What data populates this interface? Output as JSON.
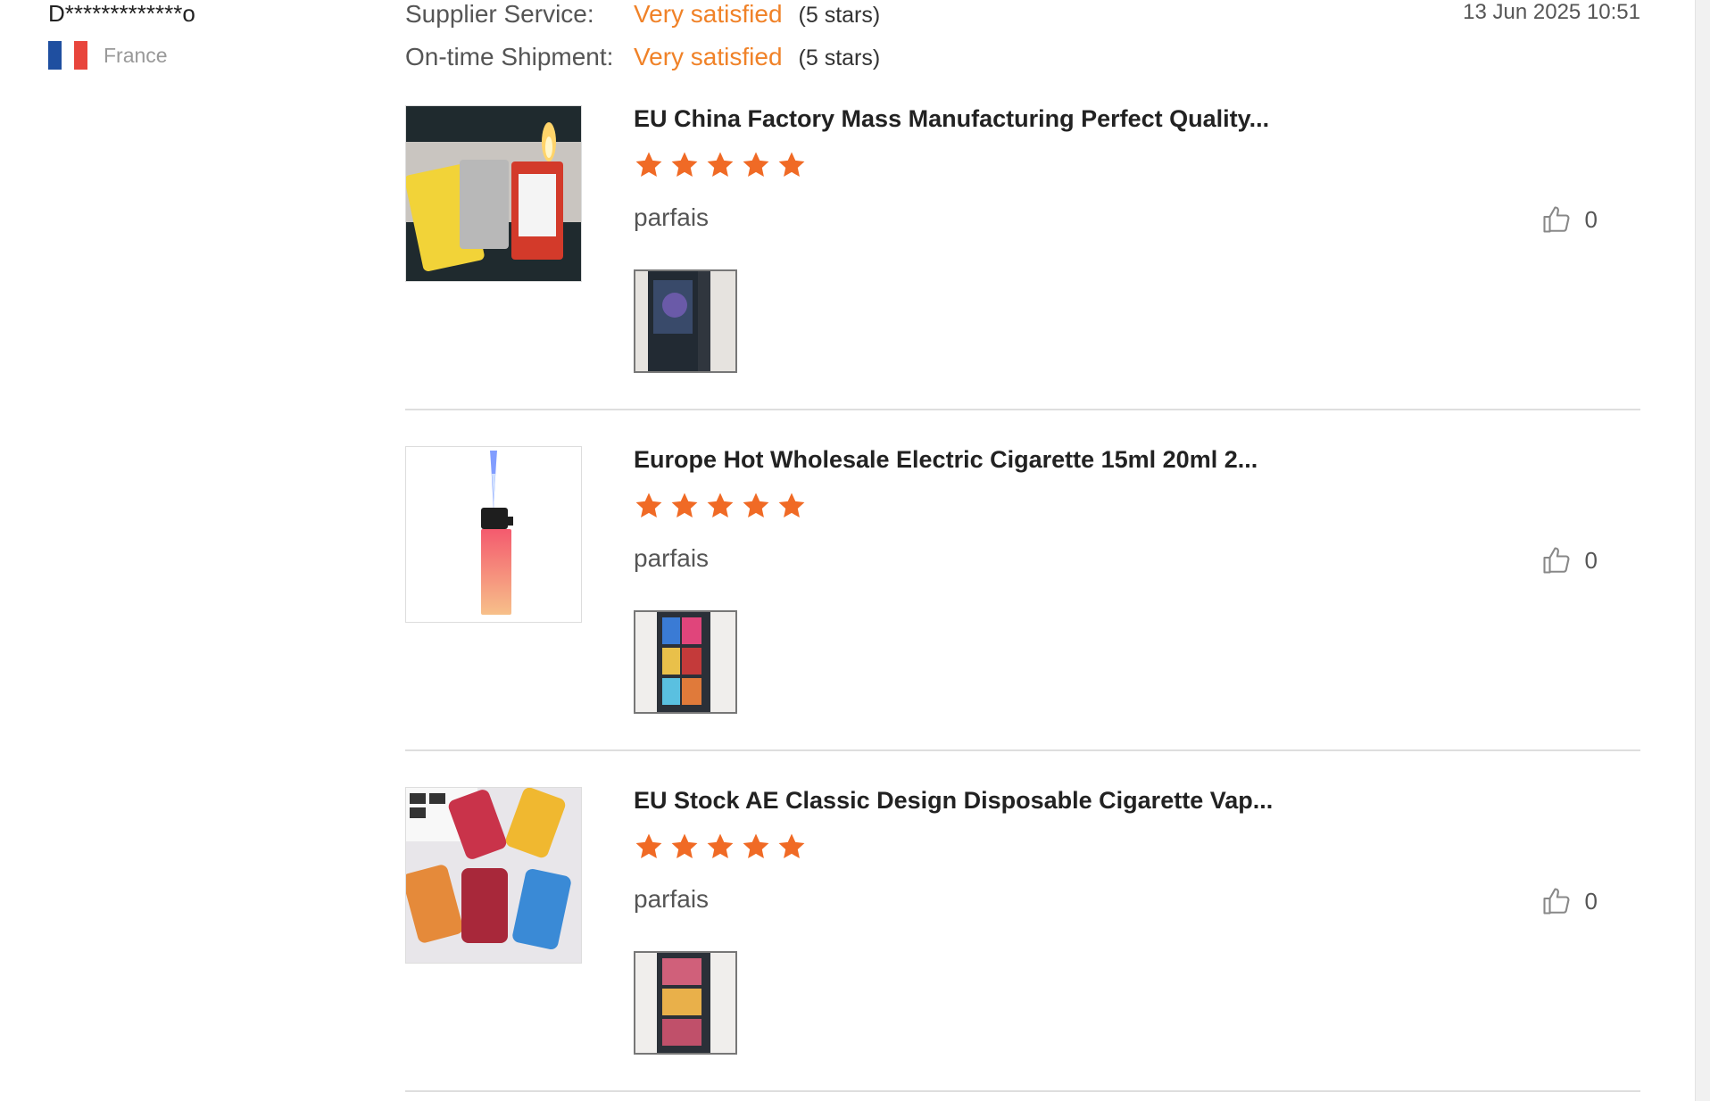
{
  "reviewer": {
    "name": "D*************o",
    "country": "France",
    "flag_colors": [
      "#1f4fa0",
      "#ffffff",
      "#e8453c"
    ]
  },
  "ratings": [
    {
      "label": "Supplier Service:",
      "value": "Very satisfied",
      "stars": "(5 stars)"
    },
    {
      "label": "On-time Shipment:",
      "value": "Very satisfied",
      "stars": "(5 stars)"
    }
  ],
  "date": "13 Jun 2025 10:51",
  "accent_color": "#f08228",
  "reviews": [
    {
      "title": "EU China Factory Mass Manufacturing Perfect Quality...",
      "rating": 5,
      "comment": "parfais",
      "likes": "0",
      "icon": "thumbs-up-icon"
    },
    {
      "title": "Europe Hot Wholesale Electric Cigarette 15ml 20ml 2...",
      "rating": 5,
      "comment": "parfais",
      "likes": "0",
      "icon": "thumbs-up-icon"
    },
    {
      "title": "EU Stock AE Classic Design Disposable Cigarette Vap...",
      "rating": 5,
      "comment": "parfais",
      "likes": "0",
      "icon": "thumbs-up-icon"
    }
  ]
}
